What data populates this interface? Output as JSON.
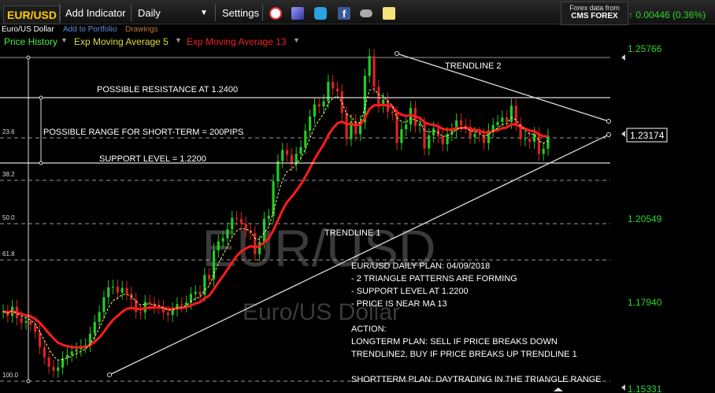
{
  "toolbar": {
    "symbol": "EUR/USD",
    "add_indicator": "Add Indicator",
    "period": "Daily",
    "period_caret": "▼",
    "settings": "Settings",
    "icons": [
      "alarm-icon",
      "cube-icon",
      "twitter-icon",
      "facebook-icon",
      "binoculars-icon",
      "note-icon"
    ]
  },
  "subbar": {
    "name": "Euro/US Dollar",
    "add_portfolio": "Add to Portfolio",
    "drawings": "Drawings"
  },
  "indicators": [
    {
      "label": "Price History",
      "color": "#44ee44"
    },
    {
      "label": "Exp Moving Average 5",
      "color": "#dddd33"
    },
    {
      "label": "Exp Moving Average 13",
      "color": "#ee2222"
    }
  ],
  "source": {
    "line1": "Forex data from",
    "line2": "CMS FOREX"
  },
  "change": {
    "arrow": "↑",
    "text": "0.00446 (0.36%)",
    "color": "#2cd62c"
  },
  "chart_data": {
    "type": "line",
    "title": "EUR/USD",
    "watermark": [
      "EUR/USD",
      "Euro/US Dollar"
    ],
    "y_ticks": [
      "1.25766",
      "1.20549",
      "1.17940",
      "1.15331"
    ],
    "current_price": "1.23174",
    "fib_levels": [
      "23.6",
      "38.2",
      "50.0",
      "61.8",
      "100.0"
    ],
    "ylim": [
      1.15331,
      1.25766
    ],
    "price_series": [
      1.1752,
      1.1738,
      1.1767,
      1.1731,
      1.1717,
      1.1722,
      1.1711,
      1.1688,
      1.164,
      1.1608,
      1.1578,
      1.1566,
      1.1576,
      1.1605,
      1.1616,
      1.1626,
      1.1633,
      1.1643,
      1.1646,
      1.1682,
      1.1719,
      1.175,
      1.1797,
      1.1828,
      1.183,
      1.1811,
      1.1826,
      1.1808,
      1.1789,
      1.1751,
      1.1749,
      1.1782,
      1.1777,
      1.1767,
      1.1766,
      1.1749,
      1.1741,
      1.1758,
      1.1775,
      1.1771,
      1.178,
      1.1807,
      1.1813,
      1.1804,
      1.1867,
      1.1853,
      1.1944,
      1.1972,
      1.1982,
      1.201,
      1.2046,
      1.2043,
      1.2028,
      1.2005,
      1.1998,
      1.1932,
      1.197,
      1.2043,
      1.2052,
      1.2161,
      1.2224,
      1.2259,
      1.2244,
      1.2215,
      1.2247,
      1.2268,
      1.232,
      1.2364,
      1.2402,
      1.2396,
      1.2412,
      1.2473,
      1.2452,
      1.2443,
      1.2375,
      1.2293,
      1.2349,
      1.2309,
      1.2346,
      1.2492,
      1.2554,
      1.2457,
      1.2398,
      1.2417,
      1.2379,
      1.2375,
      1.2281,
      1.2324,
      1.2339,
      1.2391,
      1.2335,
      1.2341,
      1.2264,
      1.2305,
      1.2326,
      1.2303,
      1.2277,
      1.2309,
      1.2321,
      1.2352,
      1.2336,
      1.2332,
      1.23,
      1.2309,
      1.2306,
      1.2281,
      1.232,
      1.2337,
      1.2347,
      1.2361,
      1.2347,
      1.2398,
      1.2341,
      1.2293,
      1.2294,
      1.2285,
      1.2309,
      1.2247,
      1.2263,
      1.2303
    ],
    "ema5": [
      1.1752,
      1.1747,
      1.1754,
      1.1746,
      1.1737,
      1.1732,
      1.1725,
      1.1713,
      1.1688,
      1.1661,
      1.1634,
      1.1611,
      1.1599,
      1.1601,
      1.1606,
      1.1613,
      1.1619,
      1.1627,
      1.1634,
      1.165,
      1.1673,
      1.1699,
      1.1732,
      1.1764,
      1.1786,
      1.1794,
      1.1805,
      1.1806,
      1.18,
      1.1784,
      1.1772,
      1.1775,
      1.1776,
      1.1773,
      1.1771,
      1.1763,
      1.1756,
      1.1757,
      1.1763,
      1.1766,
      1.177,
      1.1782,
      1.1793,
      1.1797,
      1.182,
      1.1831,
      1.1869,
      1.1903,
      1.1929,
      1.1956,
      1.1986,
      1.2005,
      1.2013,
      1.201,
      1.2006,
      1.1981,
      1.1978,
      1.2,
      1.2017,
      1.2065,
      1.2118,
      1.2165,
      1.2191,
      1.2199,
      1.2215,
      1.2233,
      1.2262,
      1.2296,
      1.2331,
      1.2353,
      1.2373,
      1.2406,
      1.2421,
      1.2428,
      1.241,
      1.2371,
      1.2364,
      1.2345,
      1.2345,
      1.2394,
      1.2447,
      1.2451,
      1.2433,
      1.2428,
      1.2411,
      1.2399,
      1.236,
      1.2348,
      1.2345,
      1.236,
      1.2352,
      1.2348,
      1.232,
      1.2315,
      1.2319,
      1.2314,
      1.2301,
      1.2304,
      1.231,
      1.2324,
      1.2328,
      1.2329,
      1.2319,
      1.2316,
      1.2313,
      1.2302,
      1.2308,
      1.2318,
      1.2328,
      1.2339,
      1.2342,
      1.2361,
      1.2354,
      1.2334,
      1.232,
      1.2309,
      1.2309,
      1.2288,
      1.228,
      1.2288
    ],
    "ema13": [
      1.1752,
      1.175,
      1.1752,
      1.1749,
      1.1744,
      1.174,
      1.1736,
      1.1729,
      1.1716,
      1.17,
      1.1683,
      1.1667,
      1.1654,
      1.1647,
      1.1643,
      1.164,
      1.1639,
      1.164,
      1.164,
      1.1646,
      1.1657,
      1.167,
      1.1688,
      1.1708,
      1.1726,
      1.1738,
      1.1751,
      1.176,
      1.1763,
      1.1761,
      1.1759,
      1.1762,
      1.1764,
      1.1765,
      1.1765,
      1.1763,
      1.176,
      1.176,
      1.1762,
      1.1763,
      1.1765,
      1.1771,
      1.1777,
      1.1781,
      1.1793,
      1.1802,
      1.1822,
      1.1843,
      1.1863,
      1.1884,
      1.1907,
      1.1926,
      1.1941,
      1.195,
      1.1957,
      1.1954,
      1.1957,
      1.1969,
      1.1981,
      1.2007,
      1.2038,
      1.207,
      1.2095,
      1.2112,
      1.2131,
      1.2151,
      1.2175,
      1.2202,
      1.223,
      1.2254,
      1.2277,
      1.2305,
      1.2326,
      1.2343,
      1.2348,
      1.234,
      1.2341,
      1.2337,
      1.2338,
      1.236,
      1.2388,
      1.2399,
      1.2399,
      1.2401,
      1.2398,
      1.2395,
      1.2378,
      1.237,
      1.2366,
      1.2369,
      1.2364,
      1.236,
      1.2346,
      1.234,
      1.2338,
      1.2333,
      1.2325,
      1.2323,
      1.2323,
      1.2327,
      1.2328,
      1.2329,
      1.2325,
      1.2322,
      1.232,
      1.2314,
      1.2315,
      1.2318,
      1.2322,
      1.2327,
      1.233,
      1.234,
      1.2339,
      1.2332,
      1.2326,
      1.232,
      1.2318,
      1.2308,
      1.2302,
      1.2302
    ],
    "annotations": {
      "trendline2": "TRENDLINE 2",
      "resistance": "POSSIBLE RESISTANCE AT 1.2400",
      "range": "POSSIBLE RANGE FOR SHORT-TERM = 200PIPS",
      "support": "SUPPORT LEVEL = 1.2200",
      "trendline1": "TRENDLINE 1",
      "plan": [
        "EUR/USD DAILY PLAN: 04/09/2018",
        "-  2 TRIANGLE PATTERNS ARE FORMING",
        "- SUPPORT LEVEL AT 1.2200",
        "- PRICE IS NEAR MA 13",
        "",
        "ACTION:",
        "LONGTERM PLAN: SELL IF PRICE BREAKS DOWN",
        "TRENDLINE2, BUY IF PRICE BREAKS UP TRENDLINE 1",
        "",
        "SHORTTERM PLAN: DAYTRADING IN THE TRIANGLE RANGE"
      ]
    },
    "colors": {
      "up": "#22cc22",
      "down": "#dd2222",
      "ema5": "#f0f080",
      "ema13": "#ff1c1c",
      "axis_green": "#2cd62c"
    }
  }
}
